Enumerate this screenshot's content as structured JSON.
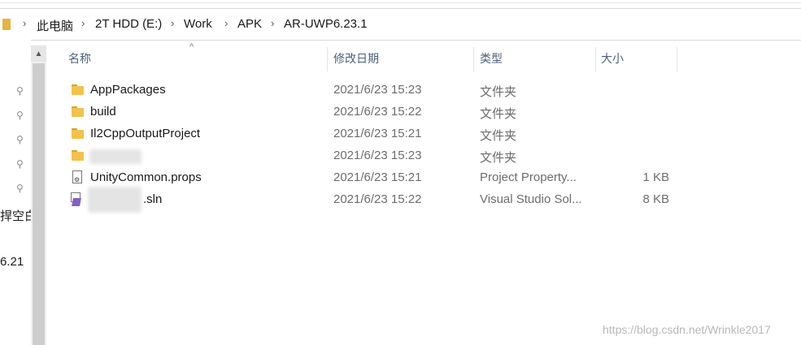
{
  "breadcrumb": {
    "items": [
      {
        "label": "此电脑"
      },
      {
        "label": "2T HDD (E:)"
      },
      {
        "label": "Work"
      },
      {
        "label": "APK"
      },
      {
        "label": "AR-UWP6.23.1"
      }
    ]
  },
  "nav": {
    "partial_text_1": "捍空白",
    "partial_text_2": "6.21"
  },
  "columns": {
    "name": "名称",
    "date": "修改日期",
    "type": "类型",
    "size": "大小"
  },
  "files": [
    {
      "name": "AppPackages",
      "date": "2021/6/23 15:23",
      "type": "文件夹",
      "size": "",
      "icon": "folder-icon"
    },
    {
      "name": "build",
      "date": "2021/6/23 15:22",
      "type": "文件夹",
      "size": "",
      "icon": "folder-icon"
    },
    {
      "name": "Il2CppOutputProject",
      "date": "2021/6/23 15:21",
      "type": "文件夹",
      "size": "",
      "icon": "folder-icon"
    },
    {
      "name": "",
      "date": "2021/6/23 15:23",
      "type": "文件夹",
      "size": "",
      "icon": "folder-icon"
    },
    {
      "name": "UnityCommon.props",
      "date": "2021/6/23 15:21",
      "type": "Project Property...",
      "size": "1 KB",
      "icon": "props-file-icon"
    },
    {
      "name": ".sln",
      "date": "2021/6/23 15:22",
      "type": "Visual Studio Sol...",
      "size": "8 KB",
      "icon": "visual-studio-solution-icon"
    }
  ],
  "watermark": "https://blog.csdn.net/Wrinkle2017",
  "colors": {
    "folder": "#f2c24b",
    "header_text": "#4c607a",
    "vs_purple": "#865fc5"
  }
}
